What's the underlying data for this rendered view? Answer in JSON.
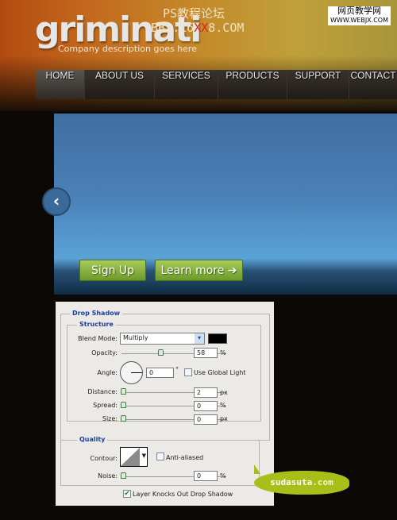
{
  "header": {
    "logo": "griminati",
    "tagline": "Company description goes here",
    "watermark_line1": "PS教程论坛",
    "watermark_line2_a": "BBS.16",
    "watermark_line2_b": "XX",
    "watermark_line2_c": "8.COM",
    "watermark_right_1": "网页教学网",
    "watermark_right_2": "WWW.WEBJX.COM"
  },
  "nav": {
    "items": [
      "HOME",
      "ABOUT US",
      "SERVICES",
      "PRODUCTS",
      "SUPPORT",
      "CONTACT"
    ],
    "active": "HOME"
  },
  "slider": {
    "prev_icon": "chevron-left-icon",
    "prev_glyph": "‹",
    "sign_up": "Sign Up",
    "learn_more": "Learn more",
    "arrow_glyph": "➔"
  },
  "dialog": {
    "title": "Drop Shadow",
    "structure": "Structure",
    "blend_mode_label": "Blend Mode:",
    "blend_mode": "Multiply",
    "shadow_color": "#000000",
    "opacity_label": "Opacity:",
    "opacity": "58",
    "opacity_unit": "%",
    "angle_label": "Angle:",
    "angle": "0",
    "angle_unit": "°",
    "global_light": "Use Global Light",
    "global_light_checked": false,
    "distance_label": "Distance:",
    "distance": "2",
    "distance_unit": "px",
    "spread_label": "Spread:",
    "spread": "0",
    "spread_unit": "%",
    "size_label": "Size:",
    "size": "0",
    "size_unit": "px",
    "quality": "Quality",
    "contour_label": "Contour:",
    "anti_aliased": "Anti-aliased",
    "anti_aliased_checked": false,
    "noise_label": "Noise:",
    "noise": "0",
    "noise_unit": "%",
    "knockout": "Layer Knocks Out Drop Shadow",
    "knockout_checked": true
  },
  "sticker": {
    "name": "sudasuta",
    "domain": ".com"
  }
}
